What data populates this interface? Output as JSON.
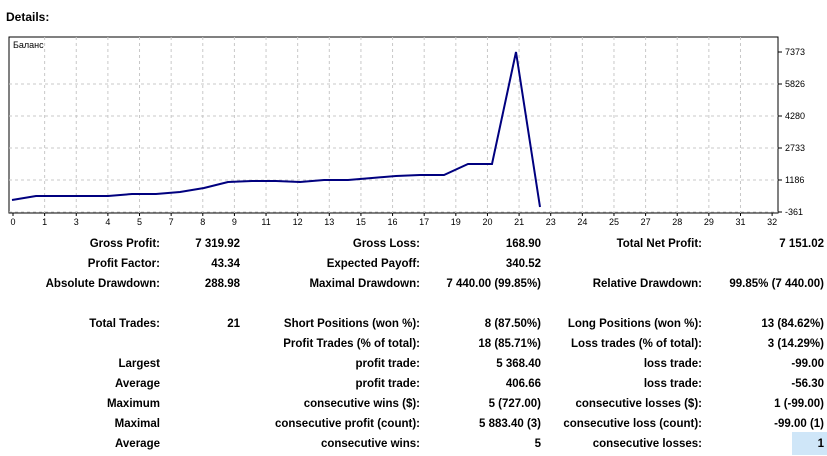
{
  "title": "Details:",
  "chart_data": {
    "type": "line",
    "legend": "Баланс",
    "series": [
      {
        "name": "Баланс",
        "x": [
          0,
          1,
          2,
          3,
          4,
          5,
          6,
          7,
          8,
          9,
          10,
          11,
          12,
          13,
          14,
          15,
          16,
          17,
          18,
          19,
          20,
          21,
          22
        ],
        "values": [
          219,
          412,
          412,
          412,
          412,
          509,
          509,
          606,
          799,
          1089,
          1138,
          1138,
          1089,
          1186,
          1186,
          1283,
          1379,
          1427,
          1427,
          1959,
          1959,
          7373,
          -119
        ]
      }
    ],
    "yticks": [
      7373,
      5826,
      4280,
      2733,
      1186,
      -361
    ],
    "xticks": [
      0,
      1,
      3,
      4,
      5,
      7,
      8,
      9,
      11,
      12,
      13,
      15,
      16,
      17,
      19,
      20,
      21,
      23,
      24,
      25,
      27,
      28,
      29,
      31,
      32
    ],
    "ylim": [
      -361,
      8100
    ],
    "xlim": [
      0,
      32
    ],
    "grid": true,
    "line_color": "#00007f"
  },
  "rows": [
    [
      "Gross Profit:",
      "7 319.92",
      "Gross Loss:",
      "168.90",
      "Total Net Profit:",
      "7 151.02"
    ],
    [
      "Profit Factor:",
      "43.34",
      "Expected Payoff:",
      "340.52",
      "",
      ""
    ],
    [
      "Absolute Drawdown:",
      "288.98",
      "Maximal Drawdown:",
      "7 440.00 (99.85%)",
      "Relative Drawdown:",
      "99.85% (7 440.00)"
    ],
    [
      "Total Trades:",
      "21",
      "Short Positions (won %):",
      "8 (87.50%)",
      "Long Positions (won %):",
      "13 (84.62%)"
    ],
    [
      "",
      "",
      "Profit Trades (% of total):",
      "18 (85.71%)",
      "Loss trades (% of total):",
      "3 (14.29%)"
    ],
    [
      "Largest",
      "",
      "profit trade:",
      "5 368.40",
      "loss trade:",
      "-99.00"
    ],
    [
      "Average",
      "",
      "profit trade:",
      "406.66",
      "loss trade:",
      "-56.30"
    ],
    [
      "Maximum",
      "",
      "consecutive wins ($):",
      "5 (727.00)",
      "consecutive losses ($):",
      "1 (-99.00)"
    ],
    [
      "Maximal",
      "",
      "consecutive profit (count):",
      "5 883.40 (3)",
      "consecutive loss (count):",
      "-99.00 (1)"
    ],
    [
      "Average",
      "",
      "consecutive wins:",
      "5",
      "consecutive losses:",
      "1"
    ]
  ]
}
